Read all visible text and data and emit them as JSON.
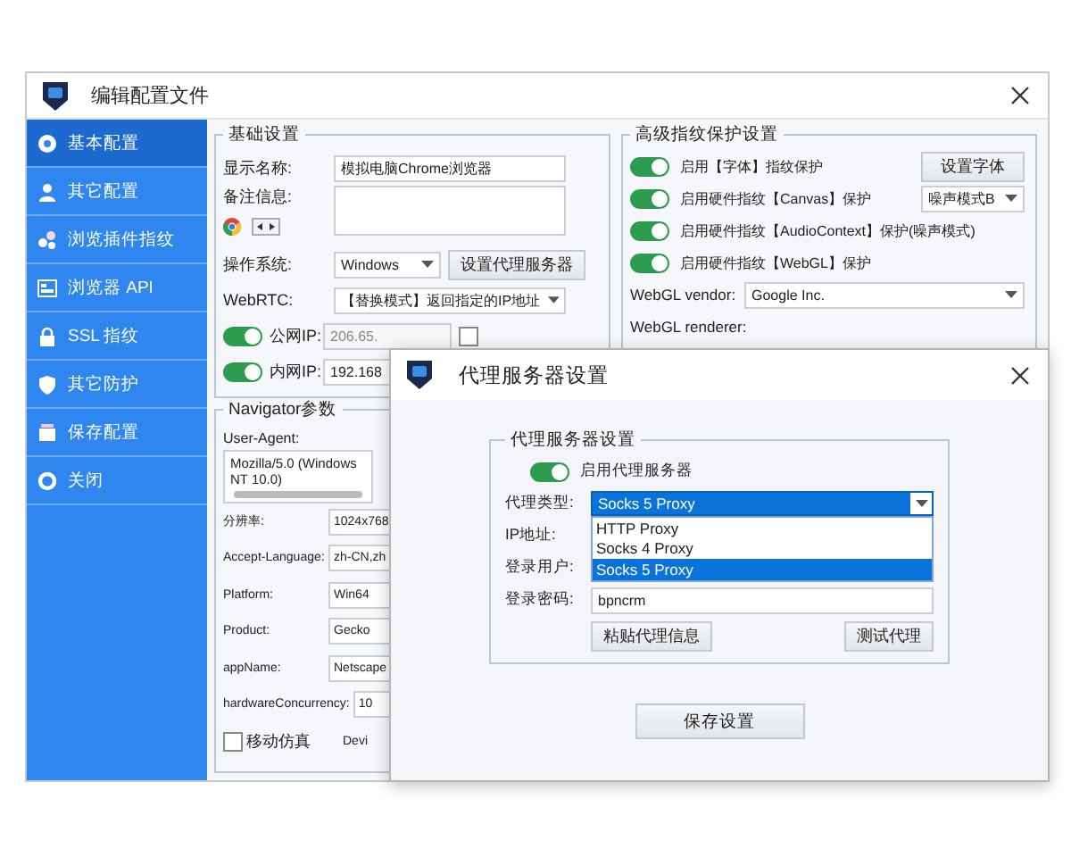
{
  "main_window": {
    "title": "编辑配置文件"
  },
  "sidebar": {
    "items": [
      {
        "label": "基本配置",
        "selected": true,
        "kind": "dot"
      },
      {
        "label": "其它配置",
        "selected": false,
        "kind": "person"
      },
      {
        "label": "浏览插件指纹",
        "selected": false,
        "kind": "cluster"
      },
      {
        "label": "浏览器 API",
        "selected": false,
        "kind": "window"
      },
      {
        "label": "SSL 指纹",
        "selected": false,
        "kind": "lock"
      },
      {
        "label": "其它防护",
        "selected": false,
        "kind": "shield"
      },
      {
        "label": "保存配置",
        "selected": false,
        "kind": "box"
      },
      {
        "label": "关闭",
        "selected": false,
        "kind": "ring"
      }
    ]
  },
  "basic_settings": {
    "title": "基础设置",
    "display_name": {
      "label": "显示名称:",
      "value": "模拟电脑Chrome浏览器"
    },
    "notes": {
      "label": "备注信息:"
    },
    "os": {
      "label": "操作系统:",
      "value": "Windows"
    },
    "proxy_button": "设置代理服务器",
    "webrtc": {
      "label": "WebRTC:",
      "value": "【替换模式】返回指定的IP地址"
    },
    "public_ip": {
      "label": "公网IP:",
      "on": true,
      "value": "206.65."
    },
    "local_ip": {
      "label": "内网IP:",
      "on": true,
      "value": "192.168"
    },
    "auto_detect": {
      "checked": false
    }
  },
  "navigator": {
    "title": "Navigator参数",
    "user_agent": {
      "label": "User-Agent:",
      "value": "Mozilla/5.0 (Windows NT 10.0)"
    },
    "fields": [
      {
        "label": "分辨率:",
        "value": "1024x768"
      },
      {
        "label": "Accept-Language:",
        "value": "zh-CN,zh"
      },
      {
        "label": "Platform:",
        "value": "Win64"
      },
      {
        "label": "Product:",
        "value": "Gecko"
      },
      {
        "label": "appName:",
        "value": "Netscape"
      },
      {
        "label": "hardwareConcurrency:",
        "value": "10"
      }
    ],
    "mobile": {
      "label": "移动仿真",
      "checked": false
    },
    "column_2_label": "Devi"
  },
  "advanced": {
    "title": "高级指纹保护设置",
    "toggles": [
      {
        "label": "启用【字体】指纹保护",
        "on": true,
        "kind": "button",
        "control": "设置字体"
      },
      {
        "label": "启用硬件指纹【Canvas】保护",
        "on": true,
        "kind": "select",
        "control": "噪声模式B"
      },
      {
        "label": "启用硬件指纹【AudioContext】保护(噪声模式)",
        "on": true,
        "kind": "plain"
      },
      {
        "label": "启用硬件指纹【WebGL】保护",
        "on": true,
        "kind": "plain"
      }
    ],
    "webgl_vendor": {
      "label": "WebGL vendor:",
      "value": "Google Inc."
    },
    "webgl_renderer": {
      "label": "WebGL renderer:"
    }
  },
  "proxy_dialog": {
    "title": "代理服务器设置",
    "group_title": "代理服务器设置",
    "enable": {
      "label": "启用代理服务器",
      "on": true
    },
    "proxy_type": {
      "label": "代理类型:",
      "value": "Socks 5 Proxy",
      "options": [
        {
          "label": "HTTP Proxy",
          "selected": false
        },
        {
          "label": "Socks 4 Proxy",
          "selected": false
        },
        {
          "label": "Socks 5 Proxy",
          "selected": true
        }
      ]
    },
    "ip_label": "IP地址:",
    "user_label": "登录用户:",
    "password": {
      "label": "登录密码:",
      "value": "bpncrm"
    },
    "paste_button": "粘贴代理信息",
    "test_button": "测试代理",
    "save_button": "保存设置"
  }
}
